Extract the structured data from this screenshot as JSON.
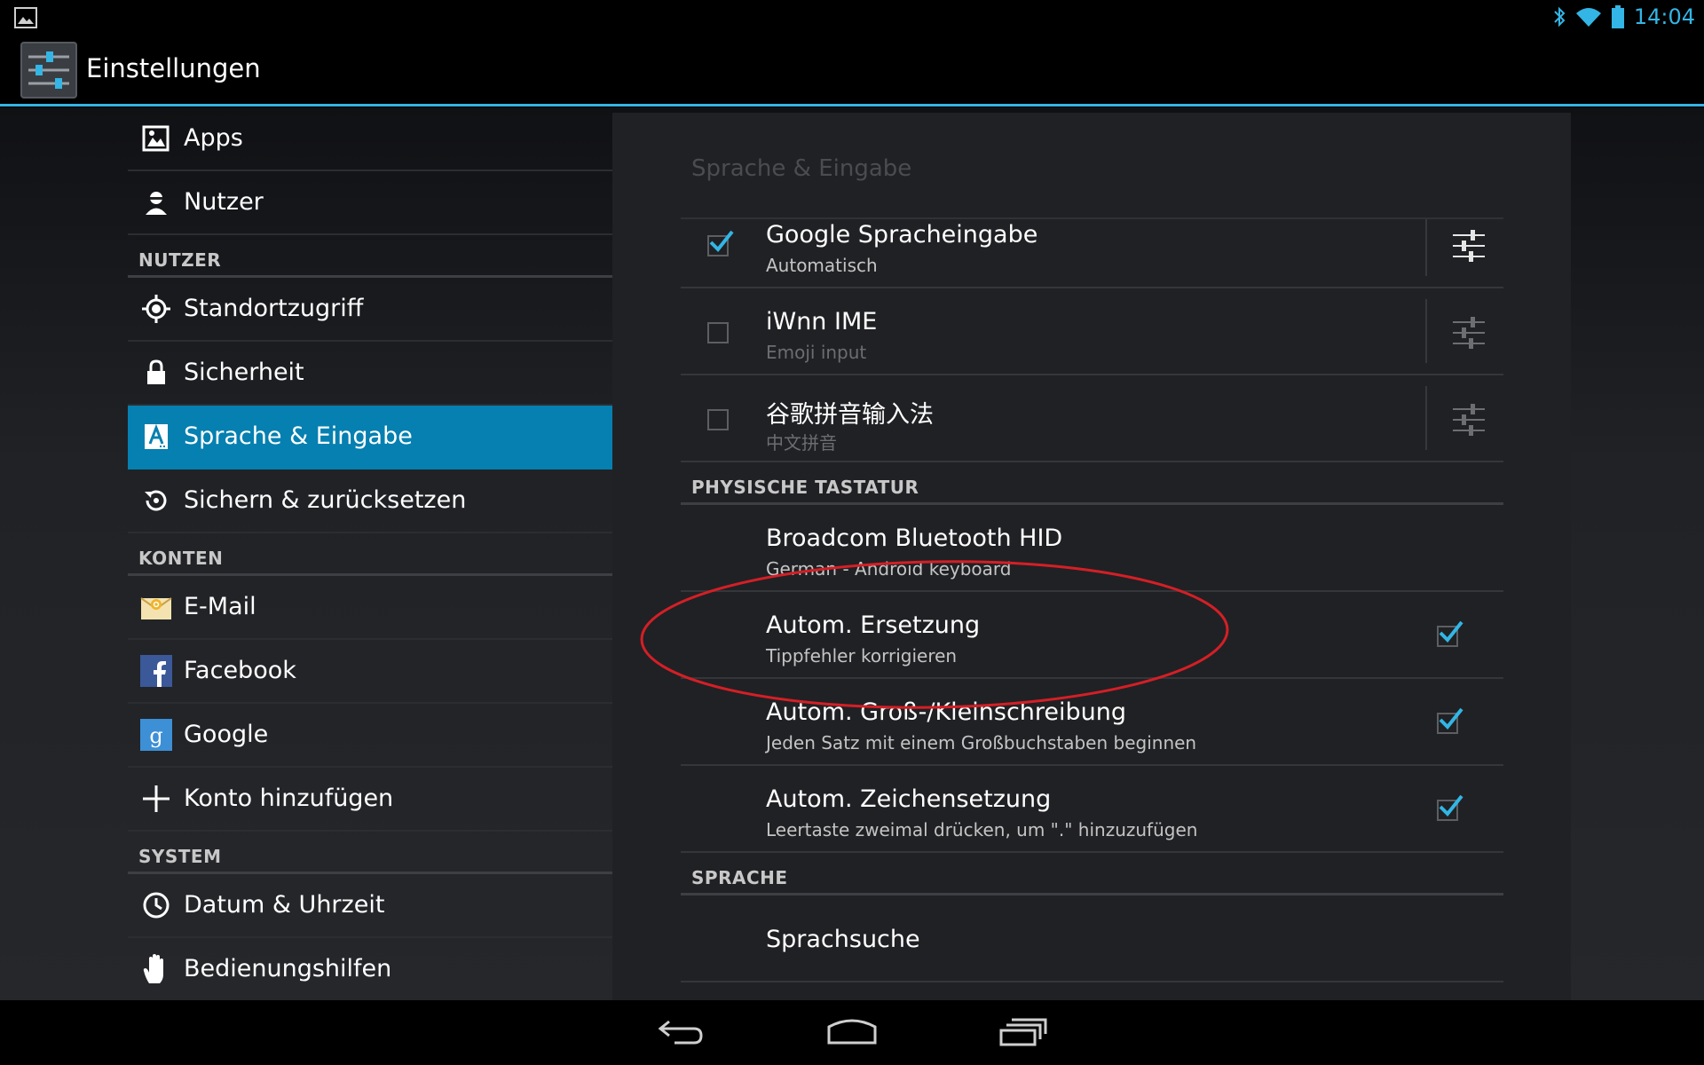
{
  "status": {
    "time": "14:04"
  },
  "actionbar": {
    "title": "Einstellungen"
  },
  "left": {
    "items": [
      {
        "label": "Apps",
        "icon": "apps-icon"
      },
      {
        "label": "Nutzer",
        "icon": "user-icon"
      },
      {
        "header": "NUTZER"
      },
      {
        "label": "Standortzugriff",
        "icon": "location-icon"
      },
      {
        "label": "Sicherheit",
        "icon": "lock-icon"
      },
      {
        "label": "Sprache & Eingabe",
        "icon": "language-icon",
        "selected": true
      },
      {
        "label": "Sichern & zurücksetzen",
        "icon": "backup-icon"
      },
      {
        "header": "KONTEN"
      },
      {
        "label": "E-Mail",
        "icon": "email-icon"
      },
      {
        "label": "Facebook",
        "icon": "facebook-icon"
      },
      {
        "label": "Google",
        "icon": "google-icon"
      },
      {
        "label": "Konto hinzufügen",
        "icon": "plus-icon"
      },
      {
        "header": "SYSTEM"
      },
      {
        "label": "Datum & Uhrzeit",
        "icon": "clock-icon"
      },
      {
        "label": "Bedienungshilfen",
        "icon": "hand-icon"
      }
    ]
  },
  "right": {
    "title": "Sprache & Eingabe",
    "keyboards": [
      {
        "title": "Google Spracheingabe",
        "subtitle": "Automatisch",
        "checked": true
      },
      {
        "title": "iWnn IME",
        "subtitle": "Emoji input",
        "checked": false
      },
      {
        "title": "谷歌拼音输入法",
        "subtitle": "中文拼音",
        "checked": false
      }
    ],
    "physical_header": "PHYSISCHE TASTATUR",
    "physical": {
      "title": "Broadcom Bluetooth HID",
      "subtitle": "German - Android keyboard"
    },
    "options": [
      {
        "title": "Autom. Ersetzung",
        "subtitle": "Tippfehler korrigieren",
        "checked": true
      },
      {
        "title": "Autom. Groß-/Kleinschreibung",
        "subtitle": "Jeden Satz mit einem Großbuchstaben beginnen",
        "checked": true
      },
      {
        "title": "Autom. Zeichensetzung",
        "subtitle": "Leertaste zweimal drücken, um \".\" hinzuzufügen",
        "checked": true
      }
    ],
    "speech_header": "SPRACHE",
    "speech": {
      "title": "Sprachsuche"
    }
  },
  "colors": {
    "accent": "#33b5e5",
    "selected": "#0580b0",
    "annotation": "#d41f26"
  }
}
